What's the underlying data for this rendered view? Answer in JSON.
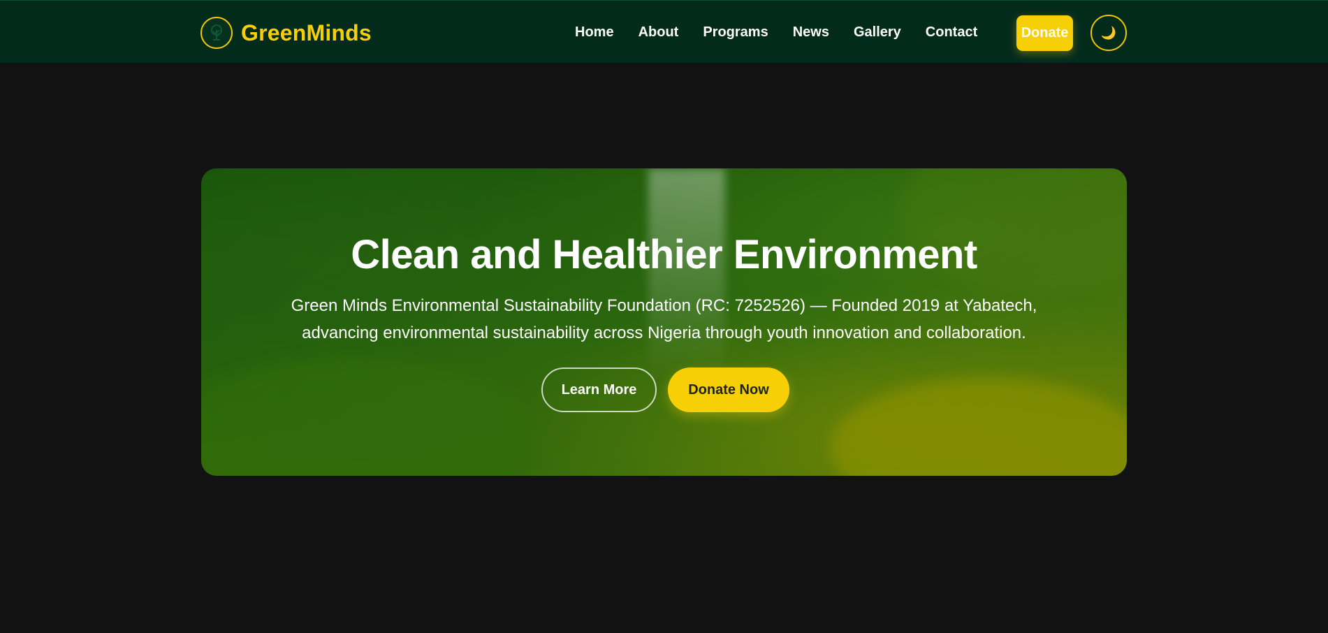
{
  "header": {
    "brand_name": "GreenMinds",
    "logo_icon": "tree-icon",
    "nav": [
      {
        "label": "Home"
      },
      {
        "label": "About"
      },
      {
        "label": "Programs"
      },
      {
        "label": "News"
      },
      {
        "label": "Gallery"
      },
      {
        "label": "Contact"
      }
    ],
    "donate_label": "Donate",
    "theme_toggle_icon": "moon-icon",
    "theme_toggle_glyph": "🌙"
  },
  "hero": {
    "title": "Clean and Healthier Environment",
    "description_line1": "Green Minds Environmental Sustainability Foundation (RC: 7252526) — Founded 2019 at Yabatech,",
    "description_line2": "advancing environmental sustainability across Nigeria through youth innovation and collaboration.",
    "learn_more_label": "Learn More",
    "donate_now_label": "Donate Now"
  },
  "colors": {
    "header_bg": "#032b1c",
    "page_bg": "#121212",
    "accent_yellow": "#f6cf07",
    "text_white": "#ffffff"
  }
}
